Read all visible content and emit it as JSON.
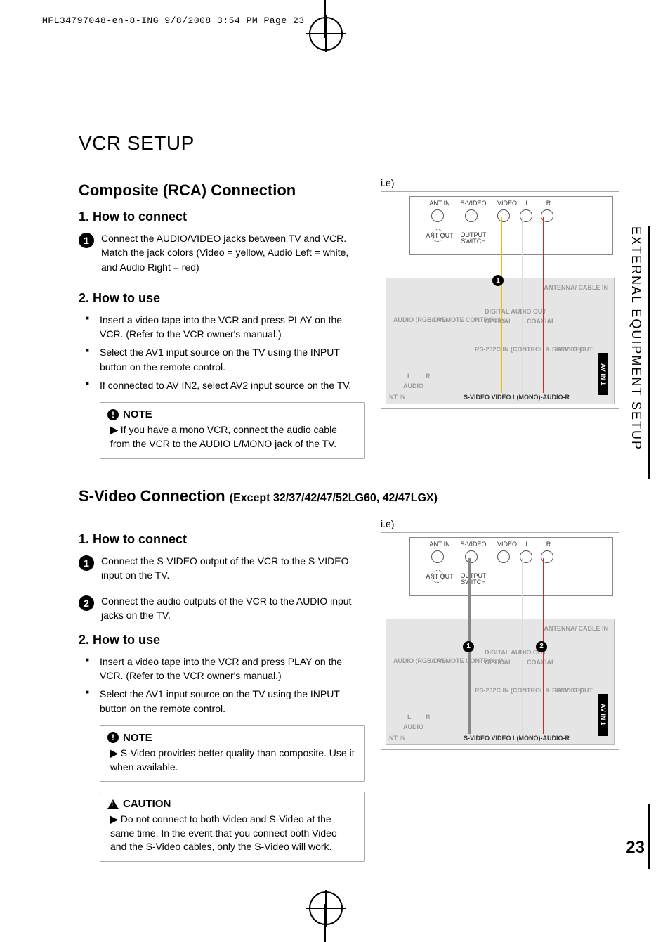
{
  "print_header": "MFL34797048-en-8-ING  9/8/2008 3:54 PM  Page 23",
  "side_tab": "EXTERNAL EQUIPMENT SETUP",
  "page_number": "23",
  "title": "VCR SETUP",
  "section1": {
    "heading": "Composite (RCA) Connection",
    "ie_label": "i.e)",
    "connect_h": "1. How to connect",
    "step1": "Connect the AUDIO/VIDEO jacks between TV and VCR. Match the jack colors (Video = yellow, Audio Left = white, and Audio Right = red)",
    "use_h": "2. How to use",
    "use_items": [
      "Insert a video tape into the VCR and press PLAY on the VCR. (Refer to the VCR owner's manual.)",
      "Select the AV1 input source on the TV using the INPUT button on the remote control.",
      "If connected to AV IN2, select AV2 input source on the TV."
    ],
    "note_title": "NOTE",
    "note_body": "If you have a mono VCR, connect the audio cable from the VCR to the AUDIO L/MONO jack of the TV."
  },
  "section2": {
    "heading": "S-Video Connection",
    "heading_sub": "(Except 32/37/42/47/52LG60, 42/47LGX)",
    "ie_label": "i.e)",
    "connect_h": "1. How to connect",
    "step1": "Connect the S-VIDEO output of the VCR to the S-VIDEO input on the TV.",
    "step2": "Connect the audio outputs of the VCR to the AUDIO input jacks on the TV.",
    "use_h": "2. How to use",
    "use_items": [
      "Insert a video tape into the VCR and press PLAY on the VCR. (Refer to the VCR owner's manual.)",
      "Select the AV1 input source on the TV using the INPUT button on the remote control."
    ],
    "note_title": "NOTE",
    "note_body": "S-Video provides better quality than composite. Use it when available.",
    "caution_title": "CAUTION",
    "caution_body": "Do not connect to both Video and S-Video at the same time. In the event that you connect both Video and the S-Video cables, only the S-Video will work."
  },
  "diagram_labels": {
    "ant_in": "ANT IN",
    "ant_out": "ANT OUT",
    "s_video": "S-VIDEO",
    "video": "VIDEO",
    "l": "L",
    "r": "R",
    "output_switch": "OUTPUT SWITCH",
    "antenna_cable": "ANTENNA/ CABLE IN",
    "audio_rgb_dvi": "AUDIO (RGB/DVI)",
    "remote_control_in": "REMOTE CONTROL IN",
    "digital_audio_out": "DIGITAL AUDIO OUT",
    "optical": "OPTICAL",
    "coaxial": "COAXIAL",
    "rs232c": "RS-232C IN (CONTROL & SERVICE)",
    "audio_out": "AUDIO OUT",
    "av_in_1": "AV IN 1",
    "bottom_row": "S-VIDEO   VIDEO  L(MONO)-AUDIO-R",
    "nt_in": "NT IN",
    "audio_lbl": "AUDIO"
  }
}
